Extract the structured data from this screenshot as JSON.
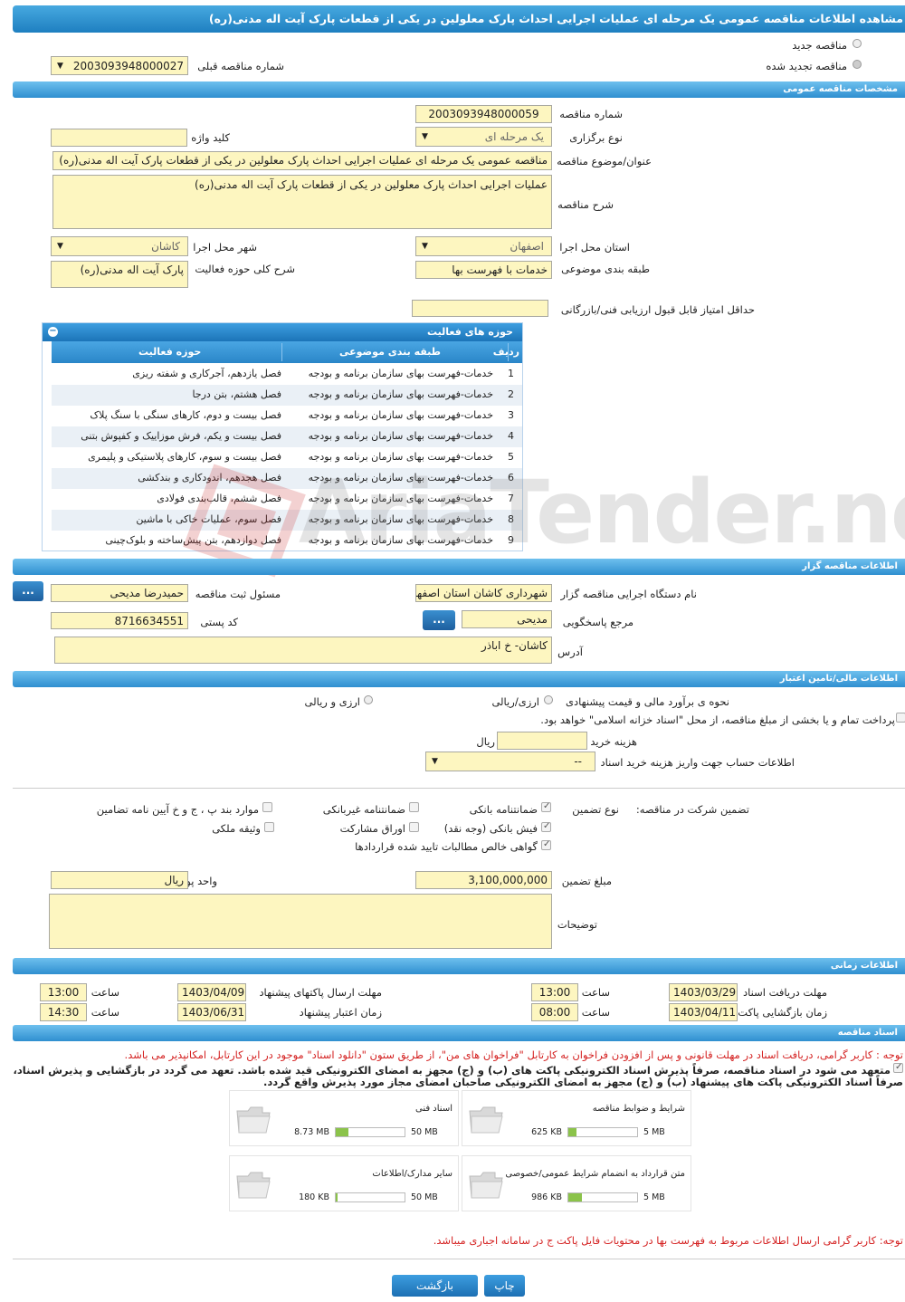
{
  "title": "مشاهده اطلاعات مناقصه عمومی یک مرحله ای عملیات اجرایی احداث پارک معلولین در یکی از قطعات پارک آیت اله مدنی(ره)",
  "options": {
    "new_tender": "مناقصه جدید",
    "renewed_tender": "مناقصه تجدید شده",
    "prev_number_label": "شماره مناقصه قبلی",
    "prev_number": "2003093948000027"
  },
  "general": {
    "header": "مشخصات مناقصه عمومی",
    "number_label": "شماره مناقصه",
    "number": "2003093948000059",
    "type_label": "نوع برگزاری",
    "type": "یک مرحله ای",
    "keyword_label": "کلید واژه",
    "keyword": "",
    "subject_label": "عنوان/موضوع مناقصه",
    "subject": "مناقصه عمومی یک مرحله ای عملیات اجرایی احداث پارک معلولین در یکی از قطعات پارک آیت اله مدنی(ره)",
    "desc_label": "شرح مناقصه",
    "desc": "عملیات اجرایی احداث پارک معلولین در یکی از قطعات پارک آیت اله مدنی(ره)",
    "province_label": "استان محل اجرا",
    "province": "اصفهان",
    "city_label": "شهر محل اجرا",
    "city": "کاشان",
    "category_label": "طبقه بندی موضوعی",
    "category": "خدمات با فهرست بها",
    "scope_label": "شرح کلی حوزه فعالیت",
    "scope": "پارک آیت اله مدنی(ره)",
    "min_score_label": "حداقل امتیاز قابل قبول ارزیابی فنی/بازرگانی",
    "min_score": ""
  },
  "activities": {
    "header": "حوزه های فعالیت",
    "col_row": "ردیف",
    "col_category": "طبقه بندی موضوعی",
    "col_scope": "حوزه فعالیت",
    "rows": [
      {
        "n": "1",
        "cat": "خدمات-فهرست بهای سازمان برنامه و بودجه",
        "scope": "فصل یازدهم، آجرکاری و شفته ریزی"
      },
      {
        "n": "2",
        "cat": "خدمات-فهرست بهای سازمان برنامه و بودجه",
        "scope": "فصل هشتم، بتن درجا"
      },
      {
        "n": "3",
        "cat": "خدمات-فهرست بهای سازمان برنامه و بودجه",
        "scope": "فصل بیست و دوم، کارهای سنگی با سنگ پلاک"
      },
      {
        "n": "4",
        "cat": "خدمات-فهرست بهای سازمان برنامه و بودجه",
        "scope": "فصل بیست و یکم، فرش موزاییک و کفپوش بتنی"
      },
      {
        "n": "5",
        "cat": "خدمات-فهرست بهای سازمان برنامه و بودجه",
        "scope": "فصل بیست و سوم، کارهای پلاستیکی و پلیمری"
      },
      {
        "n": "6",
        "cat": "خدمات-فهرست بهای سازمان برنامه و بودجه",
        "scope": "فصل هجدهم، اندودکاری و بندکشی"
      },
      {
        "n": "7",
        "cat": "خدمات-فهرست بهای سازمان برنامه و بودجه",
        "scope": "فصل ششم، قالب‌بندی فولادی"
      },
      {
        "n": "8",
        "cat": "خدمات-فهرست بهای سازمان برنامه و بودجه",
        "scope": "فصل سوم، عملیات خاکی با ماشین"
      },
      {
        "n": "9",
        "cat": "خدمات-فهرست بهای سازمان برنامه و بودجه",
        "scope": "فصل دوازدهم، بتن پیش‌ساخته و بلوک‌چینی"
      }
    ]
  },
  "watermark": "AriaTender.neT",
  "organizer": {
    "header": "اطلاعات مناقصه گزار",
    "org_label": "نام دستگاه اجرایی مناقصه گزار",
    "org": "شهرداری کاشان استان اصفهان",
    "resp_label": "مسئول ثبت مناقصه",
    "resp": "حمیدرضا مدیحی",
    "ref_label": "مرجع پاسخگویی",
    "ref": "مدیحی",
    "postal_label": "کد پستی",
    "postal": "8716634551",
    "address_label": "آدرس",
    "address": "کاشان- خ اباذر",
    "dots": "..."
  },
  "finance": {
    "header": "اطلاعات مالی/تامین اعتبار",
    "estimate_label": "نحوه ی برآورد مالی و قیمت پیشنهادی",
    "rial": "ارزی/ریالی",
    "rial_fx": "ارزی و ریالی",
    "treasury": "پرداخت تمام و یا بخشی از مبلغ مناقصه، از محل \"اسناد خزانه اسلامی\" خواهد بود.",
    "doc_cost_label": "هزینه خرید اسناد",
    "doc_cost": "",
    "rial_unit": "ریال",
    "account_label": "اطلاعات حساب جهت واریز هزینه خرید اسناد",
    "account": "--"
  },
  "guarantee": {
    "label": "تضمین شرکت در مناقصه:",
    "type_label": "نوع تضمین",
    "opts": [
      "ضمانتنامه بانکی",
      "ضمانتنامه غیربانکی",
      "موارد بند پ ، ج و خ آیین نامه تضامین",
      "فیش بانکی (وجه نقد)",
      "اوراق مشارکت",
      "وثیقه ملکی",
      "گواهی خالص مطالبات تایید شده قراردادها"
    ],
    "amount_label": "مبلغ تضمین",
    "amount": "3,100,000,000",
    "currency_label": "واحد پول",
    "currency": "ریال",
    "notes_label": "توضیحات",
    "notes": ""
  },
  "timing": {
    "header": "اطلاعات زمانی",
    "receive_label": "مهلت دریافت اسناد",
    "receive_date": "1403/03/29",
    "receive_time": "13:00",
    "send_label": "مهلت ارسال پاکتهای پیشنهاد",
    "send_date": "1403/04/09",
    "send_time": "13:00",
    "open_label": "زمان بازگشایی پاکت ها",
    "open_date": "1403/04/11",
    "open_time": "08:00",
    "valid_label": "زمان اعتبار پیشنهاد",
    "valid_date": "1403/06/31",
    "valid_time": "14:30",
    "time_label": "ساعت"
  },
  "docs": {
    "header": "اسناد مناقصه",
    "note1": "توجه : کاربر گرامی، دریافت اسناد در مهلت قانونی و پس از افزودن فراخوان به کارتابل \"فراخوان های من\"، از طریق ستون \"دانلود اسناد\" موجود در این کارتابل، امکانپذیر می باشد.",
    "note2": "متعهد می شود در اسناد مناقصه، صرفاً پذیرش اسناد الکترونیکی پاکت های (ب) و (ج) مجهز به امضای الکترونیکی قید شده باشد. تعهد می گردد در بازگشایی و پذیرش اسناد،",
    "note3": "صرفاً اسناد الکترونیکی پاکت های پیشنهاد (ب) و (ج) مجهز به امضای الکترونیکی صاحبان امضای مجاز مورد پذیرش واقع گردد.",
    "files": [
      {
        "title": "شرایط و ضوابط مناقصه",
        "size": "625 KB",
        "max": "5 MB",
        "fill": 0.12
      },
      {
        "title": "اسناد فنی",
        "size": "8.73 MB",
        "max": "50 MB",
        "fill": 0.18
      },
      {
        "title": "متن قرارداد به انضمام شرایط عمومی/خصوصی",
        "size": "986 KB",
        "max": "5 MB",
        "fill": 0.2
      },
      {
        "title": "سایر مدارک/اطلاعات",
        "size": "180 KB",
        "max": "50 MB",
        "fill": 0.01
      }
    ],
    "note4": "توجه: کاربر گرامی ارسال اطلاعات مربوط به فهرست بها در محتویات فایل پاکت ج در سامانه اجباری میباشد."
  },
  "buttons": {
    "print": "چاپ",
    "back": "بازگشت"
  }
}
